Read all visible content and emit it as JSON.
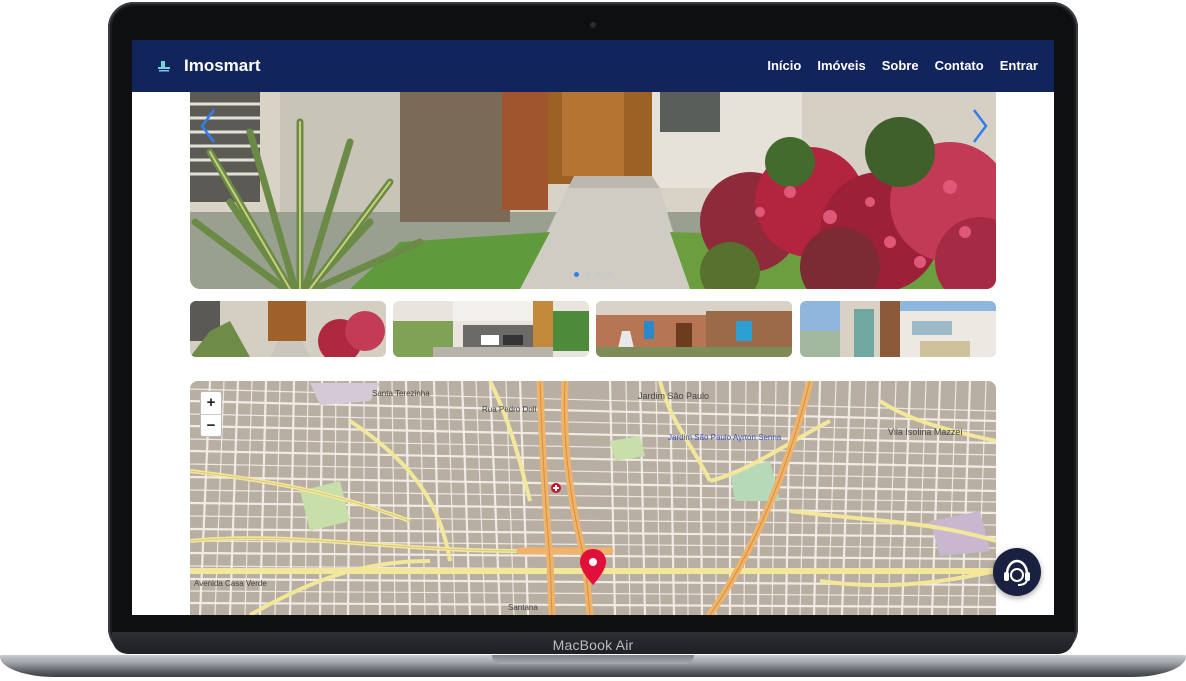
{
  "device": {
    "label": "MacBook Air"
  },
  "navbar": {
    "brand": "Imosmart",
    "links": [
      "Início",
      "Imóveis",
      "Sobre",
      "Contato",
      "Entrar"
    ]
  },
  "carousel": {
    "slide_count": 4,
    "active_index": 0,
    "prev_icon": "chevron-left-icon",
    "next_icon": "chevron-right-icon"
  },
  "thumbnails": [
    "house-garden",
    "house-garage",
    "house-fountain",
    "house-modern"
  ],
  "map": {
    "zoom_in": "+",
    "zoom_out": "−",
    "labels": {
      "santa_terezinha": "Santa Terezinha",
      "pedro_doll": "Rua Pedro Doll",
      "jardim_sao_paulo": "Jardim São Paulo",
      "metro_station": "Jardim São Paulo Ayrton Senna",
      "vila_isolina": "Vila Isolina Mazzei",
      "casa_verde": "Avenida Casa Verde",
      "santana": "Santana"
    }
  },
  "colors": {
    "navbar": "#12245c",
    "accent": "#2f7ff0",
    "marker": "#e0103a"
  },
  "support": {
    "icon": "headset-icon"
  }
}
